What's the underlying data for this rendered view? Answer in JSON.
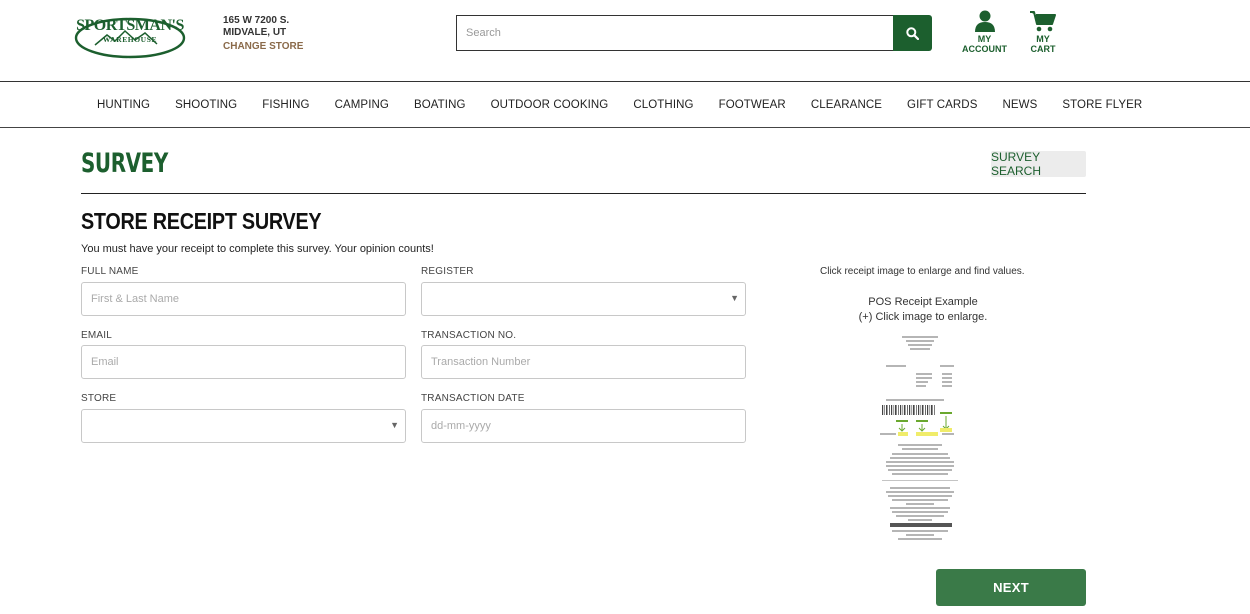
{
  "brand": {
    "name_top": "SPORTSMAN'S",
    "name_bottom": "WAREHOUSE",
    "color": "#1c5f2e"
  },
  "store": {
    "address_line1": "165 W 7200 S.",
    "address_line2": "MIDVALE, UT",
    "change_label": "CHANGE STORE"
  },
  "search": {
    "placeholder": "Search",
    "icon": "search-icon"
  },
  "account": {
    "line1": "MY",
    "line2": "ACCOUNT",
    "icon": "person-icon"
  },
  "cart": {
    "line1": "MY",
    "line2": "CART",
    "icon": "cart-icon"
  },
  "nav": {
    "items": [
      {
        "label": "HUNTING"
      },
      {
        "label": "SHOOTING"
      },
      {
        "label": "FISHING"
      },
      {
        "label": "CAMPING"
      },
      {
        "label": "BOATING"
      },
      {
        "label": "OUTDOOR COOKING"
      },
      {
        "label": "CLOTHING"
      },
      {
        "label": "FOOTWEAR"
      },
      {
        "label": "CLEARANCE"
      },
      {
        "label": "GIFT CARDS"
      },
      {
        "label": "NEWS"
      },
      {
        "label": "STORE FLYER"
      }
    ]
  },
  "page": {
    "title": "SURVEY",
    "survey_search_label": "SURVEY SEARCH"
  },
  "form": {
    "title": "STORE RECEIPT SURVEY",
    "description": "You must have your receipt to complete this survey. Your opinion counts!",
    "fields": {
      "full_name": {
        "label": "FULL NAME",
        "placeholder": "First & Last Name"
      },
      "register": {
        "label": "REGISTER",
        "value": ""
      },
      "email": {
        "label": "EMAIL",
        "placeholder": "Email"
      },
      "transaction_no": {
        "label": "TRANSACTION NO.",
        "placeholder": "Transaction Number"
      },
      "store": {
        "label": "STORE",
        "value": ""
      },
      "transaction_date": {
        "label": "TRANSACTION DATE",
        "placeholder": "dd-mm-yyyy"
      }
    },
    "next_label": "NEXT"
  },
  "receipt_help": {
    "hint": "Click receipt image to enlarge and find values.",
    "example_title": "POS Receipt Example",
    "example_subtitle": "(+) Click image to enlarge."
  },
  "colors": {
    "brand_green": "#1c5f2e",
    "button_green": "#3a7a48",
    "change_store": "#8a6a4a"
  }
}
